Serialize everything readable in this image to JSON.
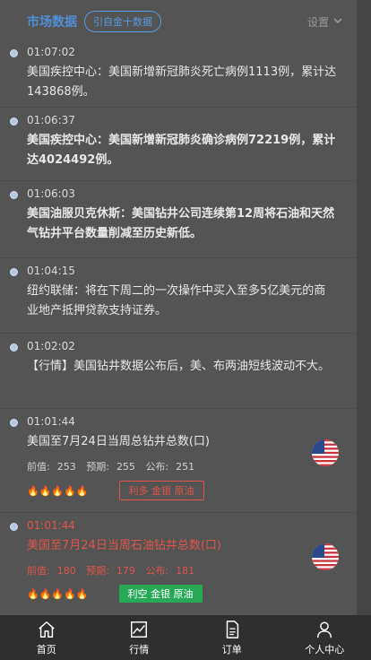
{
  "header": {
    "title": "市场数据",
    "source": "引自金十数据",
    "settings": "设置"
  },
  "items": [
    {
      "time": "01:07:02",
      "text": "美国疾控中心：美国新增新冠肺炎死亡病例1113例，累计达143868例。"
    },
    {
      "time": "01:06:37",
      "text": "美国疾控中心：美国新增新冠肺炎确诊病例72219例，累计达4024492例。"
    },
    {
      "time": "01:06:03",
      "text": "美国油服贝克休斯：美国钻井公司连续第12周将石油和天然气钻井平台数量削减至历史新低。"
    },
    {
      "time": "01:04:15",
      "text": "纽约联储：将在下周二的一次操作中买入至多5亿美元的商业地产抵押贷款支持证券。"
    },
    {
      "time": "01:02:02",
      "text": "【行情】美国钻井数据公布后，美、布两油短线波动不大。"
    }
  ],
  "data_items": [
    {
      "time": "01:01:44",
      "text": "美国至7月24日当周总钻井总数(口)",
      "prev_label": "前值:",
      "prev": "253",
      "forecast_label": "预期:",
      "forecast": "255",
      "actual_label": "公布:",
      "actual": "251",
      "importance": 2,
      "tag": "利多 金银 原油"
    },
    {
      "time": "01:01:44",
      "text": "美国至7月24日当周石油钻井总数(口)",
      "prev_label": "前值:",
      "prev": "180",
      "forecast_label": "预期:",
      "forecast": "179",
      "actual_label": "公布:",
      "actual": "181",
      "importance": 3,
      "tag": "利空 金银 原油"
    }
  ],
  "tabs": [
    {
      "label": "首页",
      "icon": "home-icon"
    },
    {
      "label": "行情",
      "icon": "chart-icon"
    },
    {
      "label": "订单",
      "icon": "document-icon"
    },
    {
      "label": "个人中心",
      "icon": "user-icon"
    }
  ],
  "colors": {
    "accent": "#4f8fd6",
    "red": "#e0564c",
    "green": "#27a956",
    "background": "#545454",
    "tabbar": "#2f2f2f"
  }
}
